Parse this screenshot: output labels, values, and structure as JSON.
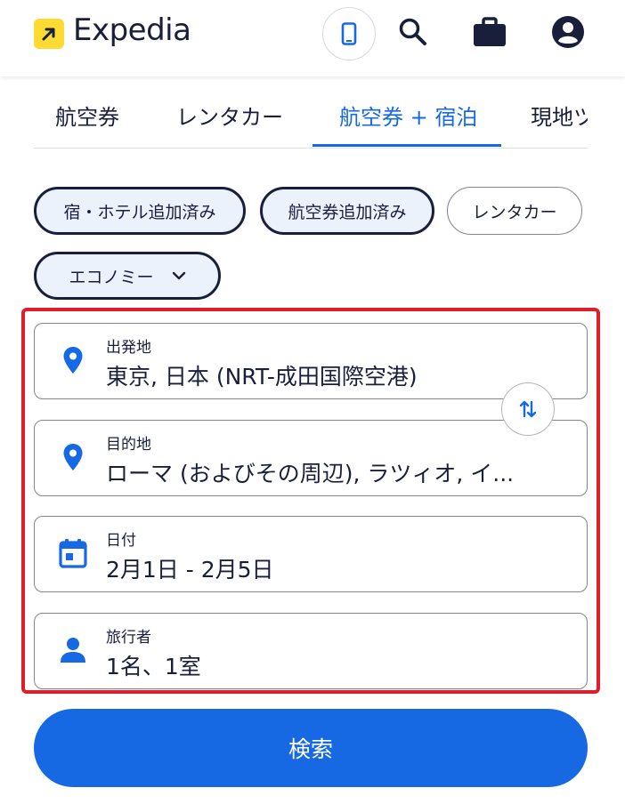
{
  "app": {
    "name": "Expedia"
  },
  "colors": {
    "primary": "#1668e3",
    "logo_bg": "#fddb32",
    "text": "#191e3b",
    "highlight": "#e11d2b"
  },
  "header": {
    "icons": [
      "phone-icon",
      "search-icon",
      "briefcase-icon",
      "account-icon"
    ]
  },
  "tabs": [
    {
      "label": "航空券"
    },
    {
      "label": "レンタカー"
    },
    {
      "label": "航空券 + 宿泊",
      "active": true
    },
    {
      "label": "現地ツ"
    }
  ],
  "chips": {
    "hotel": "宿・ホテル追加済み",
    "flight": "航空券追加済み",
    "car": "レンタカー",
    "cabin": "エコノミー"
  },
  "form": {
    "origin": {
      "label": "出発地",
      "value": "東京, 日本 (NRT-成田国際空港)"
    },
    "destination": {
      "label": "目的地",
      "value": "ローマ (およびその周辺), ラツィオ, イ..."
    },
    "dates": {
      "label": "日付",
      "value": "2月1日 - 2月5日"
    },
    "travelers": {
      "label": "旅行者",
      "value": "1名、1室"
    }
  },
  "search_button": "検索"
}
